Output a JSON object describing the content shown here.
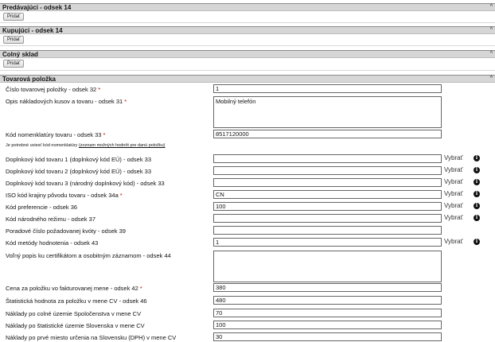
{
  "sections": {
    "seller": {
      "title": "Predávajúci - odsek 14",
      "add_label": "Pridať"
    },
    "buyer": {
      "title": "Kupujúci - odsek 14",
      "add_label": "Pridať"
    },
    "warehouse": {
      "title": "Colný sklad",
      "add_label": "Pridať"
    },
    "item": {
      "title": "Tovarová položka"
    }
  },
  "collapse_glyph": "^",
  "required_mark": "*",
  "pick_label": "Vybrať",
  "info_glyph": "i",
  "fields": {
    "item_number": {
      "label": "Číslo tovarovej položky - odsek 32",
      "value": "1"
    },
    "description": {
      "label": "Opis nákladových kusov a tovaru - odsek 31",
      "value": "Mobilný telefón"
    },
    "commodity_code": {
      "label": "Kód nomenklatúry tovaru - odsek 33",
      "value": "8517120000"
    },
    "note_text": "Je potrebné uviesť kód nomenklatúry",
    "note_link": "(zoznam možných hodnôt pre danú položku)",
    "additional_code_1": {
      "label": "Doplnkový kód tovaru 1 (doplnkový kód EÚ) - odsek 33",
      "value": ""
    },
    "additional_code_2": {
      "label": "Doplnkový kód tovaru 2 (doplnkový kód EÚ) - odsek 33",
      "value": ""
    },
    "additional_code_3": {
      "label": "Doplnkový kód tovaru 3 (národný doplnkový kód) - odsek 33",
      "value": ""
    },
    "country_origin": {
      "label": "ISO kód krajiny pôvodu tovaru - odsek 34a",
      "value": "CN"
    },
    "preference_code": {
      "label": "Kód preferencie - odsek 36",
      "value": "100"
    },
    "national_procedure": {
      "label": "Kód národného režimu - odsek 37",
      "value": ""
    },
    "quota_number": {
      "label": "Poradové číslo požadovanej kvóty - odsek 39",
      "value": ""
    },
    "valuation_method": {
      "label": "Kód metódy hodnotenia - odsek 43",
      "value": "1"
    },
    "free_text": {
      "label": "Voľný popis ku certifikátom a osobitným záznamom - odsek 44",
      "value": ""
    },
    "item_price": {
      "label": "Cena za položku vo fakturovanej mene - odsek 42",
      "value": "380"
    },
    "statistical_value": {
      "label": "Štatistická hodnota za položku v mene CV - odsek 46",
      "value": "480"
    },
    "costs_customs_territory": {
      "label": "Náklady po colné územie Spoločenstva v mene CV",
      "value": "70"
    },
    "costs_statistical_territory": {
      "label": "Náklady po štatistické územie Slovenska v mene CV",
      "value": "100"
    },
    "costs_first_destination": {
      "label": "Náklady po prvé miesto určenia na Slovensku (DPH) v mene CV",
      "value": "30"
    }
  }
}
